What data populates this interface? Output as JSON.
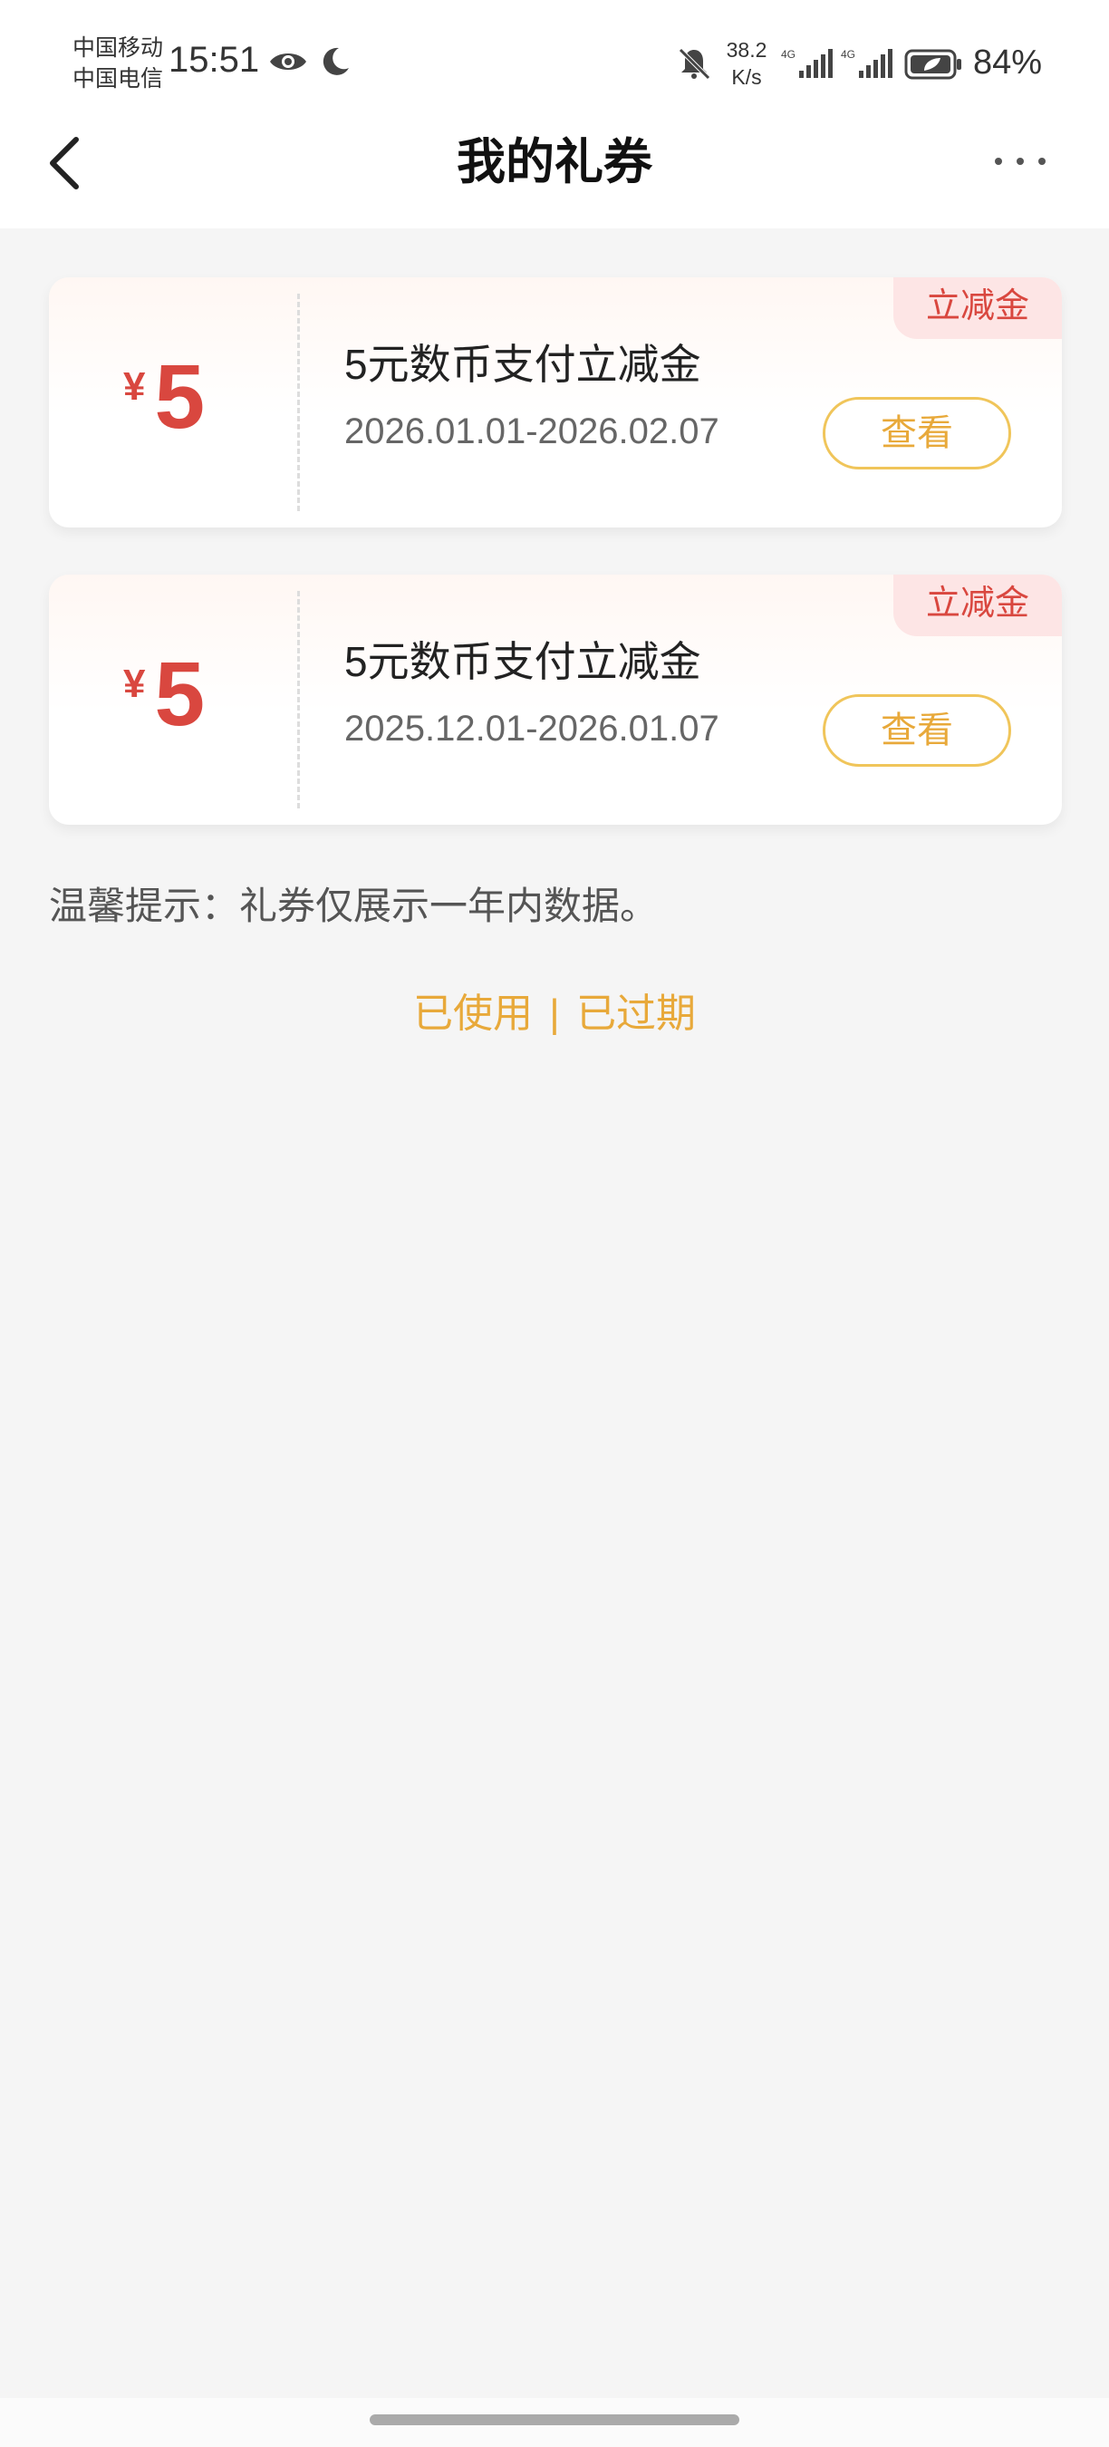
{
  "status_bar": {
    "carrier1": "中国移动",
    "carrier2": "中国电信",
    "time": "15:51",
    "net_speed_value": "38.2",
    "net_speed_unit": "K/s",
    "signal1_label": "4G",
    "signal2_label": "4G",
    "battery": "84%"
  },
  "header": {
    "title": "我的礼券"
  },
  "coupons": [
    {
      "currency": "¥",
      "amount": "5",
      "title": "5元数币支付立减金",
      "date_range": "2026.01.01-2026.02.07",
      "button": "查看",
      "tag": "立减金"
    },
    {
      "currency": "¥",
      "amount": "5",
      "title": "5元数币支付立减金",
      "date_range": "2025.12.01-2026.01.07",
      "button": "查看",
      "tag": "立减金"
    }
  ],
  "tip": "温馨提示：礼券仅展示一年内数据。",
  "links": {
    "used": "已使用",
    "separator": "|",
    "expired": "已过期"
  },
  "colors": {
    "accent_red": "#d9473f",
    "accent_gold": "#e8a93a"
  }
}
